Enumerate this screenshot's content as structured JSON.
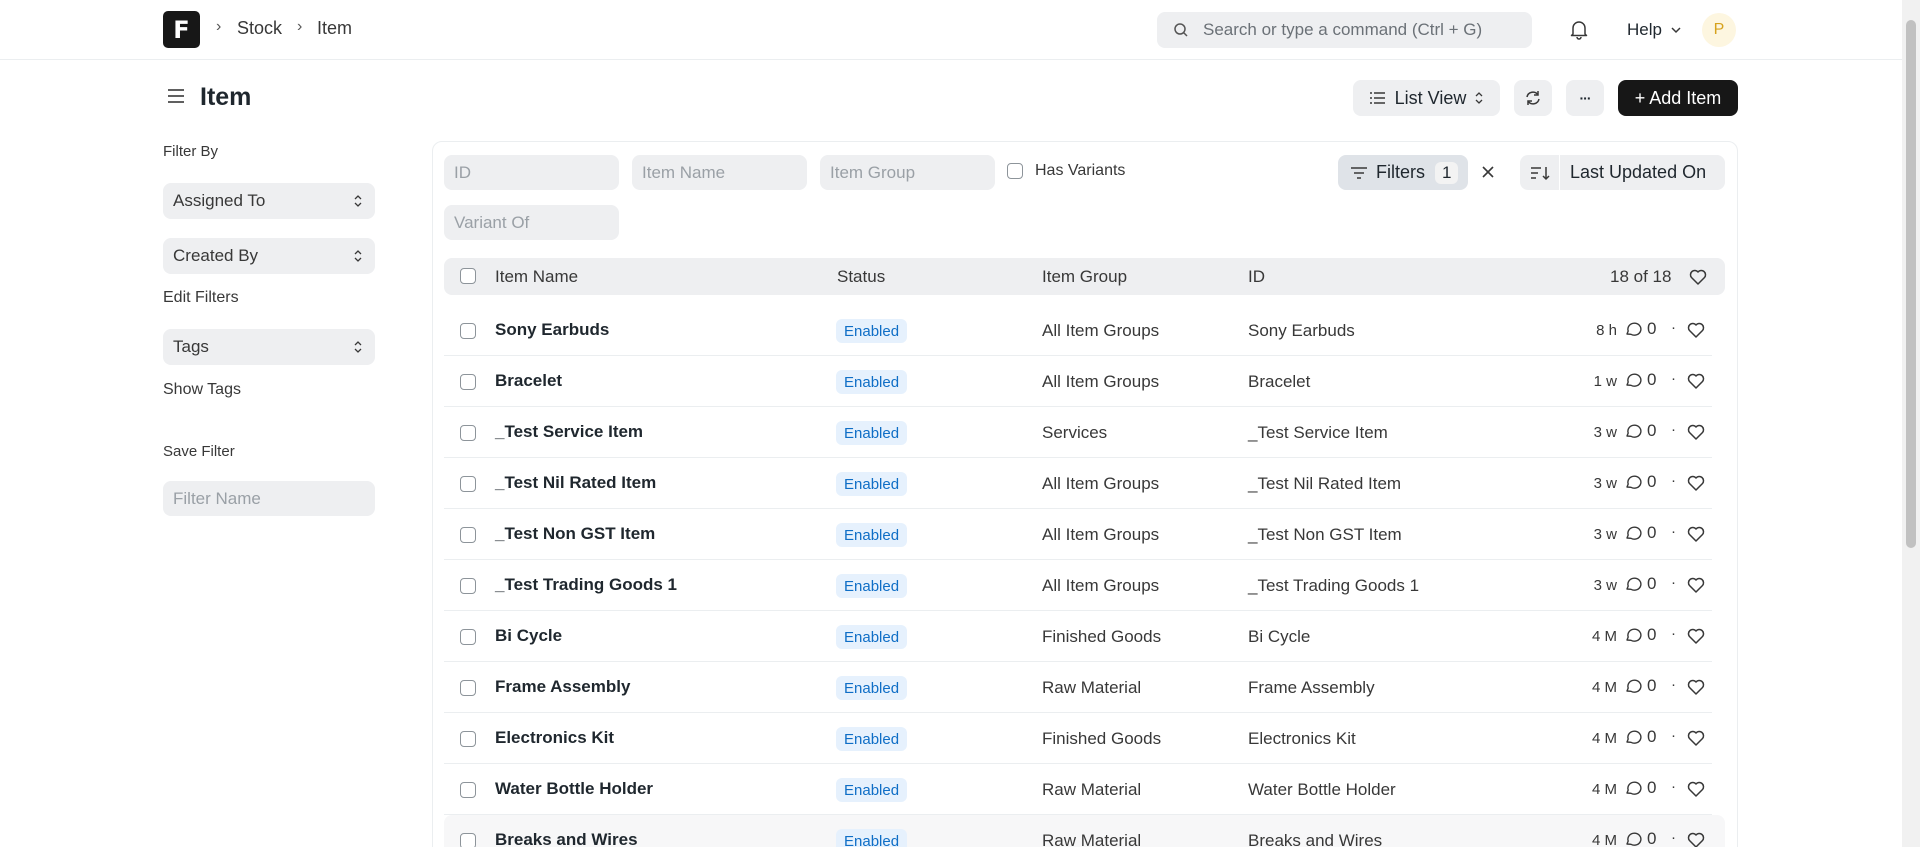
{
  "navbar": {
    "logo": "F",
    "breadcrumbs": [
      "Stock",
      "Item"
    ],
    "search_placeholder": "Search or type a command (Ctrl + G)",
    "help_label": "Help",
    "avatar_initial": "P"
  },
  "page": {
    "title": "Item",
    "list_view_label": "List View",
    "more_label": "···",
    "add_button": "+ Add Item"
  },
  "sidebar": {
    "filter_by": "Filter By",
    "assigned_to": "Assigned To",
    "created_by": "Created By",
    "edit_filters": "Edit Filters",
    "tags": "Tags",
    "show_tags": "Show Tags",
    "save_filter": "Save Filter",
    "filter_name_placeholder": "Filter Name"
  },
  "filters": {
    "id_placeholder": "ID",
    "item_name_placeholder": "Item Name",
    "item_group_placeholder": "Item Group",
    "has_variants": "Has Variants",
    "variant_of_placeholder": "Variant Of",
    "filters_label": "Filters",
    "filters_count": "1",
    "sort_label": "Last Updated On"
  },
  "table": {
    "headers": {
      "item_name": "Item Name",
      "status": "Status",
      "item_group": "Item Group",
      "id": "ID",
      "count": "18 of 18"
    },
    "rows": [
      {
        "name": "Sony Earbuds",
        "status": "Enabled",
        "group": "All Item Groups",
        "id": "Sony Earbuds",
        "time": "8 h",
        "comments": "0"
      },
      {
        "name": "Bracelet",
        "status": "Enabled",
        "group": "All Item Groups",
        "id": "Bracelet",
        "time": "1 w",
        "comments": "0"
      },
      {
        "name": "_Test Service Item",
        "status": "Enabled",
        "group": "Services",
        "id": "_Test Service Item",
        "time": "3 w",
        "comments": "0"
      },
      {
        "name": "_Test Nil Rated Item",
        "status": "Enabled",
        "group": "All Item Groups",
        "id": "_Test Nil Rated Item",
        "time": "3 w",
        "comments": "0"
      },
      {
        "name": "_Test Non GST Item",
        "status": "Enabled",
        "group": "All Item Groups",
        "id": "_Test Non GST Item",
        "time": "3 w",
        "comments": "0"
      },
      {
        "name": "_Test Trading Goods 1",
        "status": "Enabled",
        "group": "All Item Groups",
        "id": "_Test Trading Goods 1",
        "time": "3 w",
        "comments": "0"
      },
      {
        "name": "Bi Cycle",
        "status": "Enabled",
        "group": "Finished Goods",
        "id": "Bi Cycle",
        "time": "4 M",
        "comments": "0"
      },
      {
        "name": "Frame Assembly",
        "status": "Enabled",
        "group": "Raw Material",
        "id": "Frame Assembly",
        "time": "4 M",
        "comments": "0"
      },
      {
        "name": "Electronics Kit",
        "status": "Enabled",
        "group": "Finished Goods",
        "id": "Electronics Kit",
        "time": "4 M",
        "comments": "0"
      },
      {
        "name": "Water Bottle Holder",
        "status": "Enabled",
        "group": "Raw Material",
        "id": "Water Bottle Holder",
        "time": "4 M",
        "comments": "0"
      },
      {
        "name": "Breaks and Wires",
        "status": "Enabled",
        "group": "Raw Material",
        "id": "Breaks and Wires",
        "time": "4 M",
        "comments": "0"
      }
    ]
  },
  "colors": {
    "primary": "#171717",
    "badge_bg": "#e6f1fd",
    "badge_text": "#0f6ec6",
    "control_bg": "#eeeff1"
  }
}
